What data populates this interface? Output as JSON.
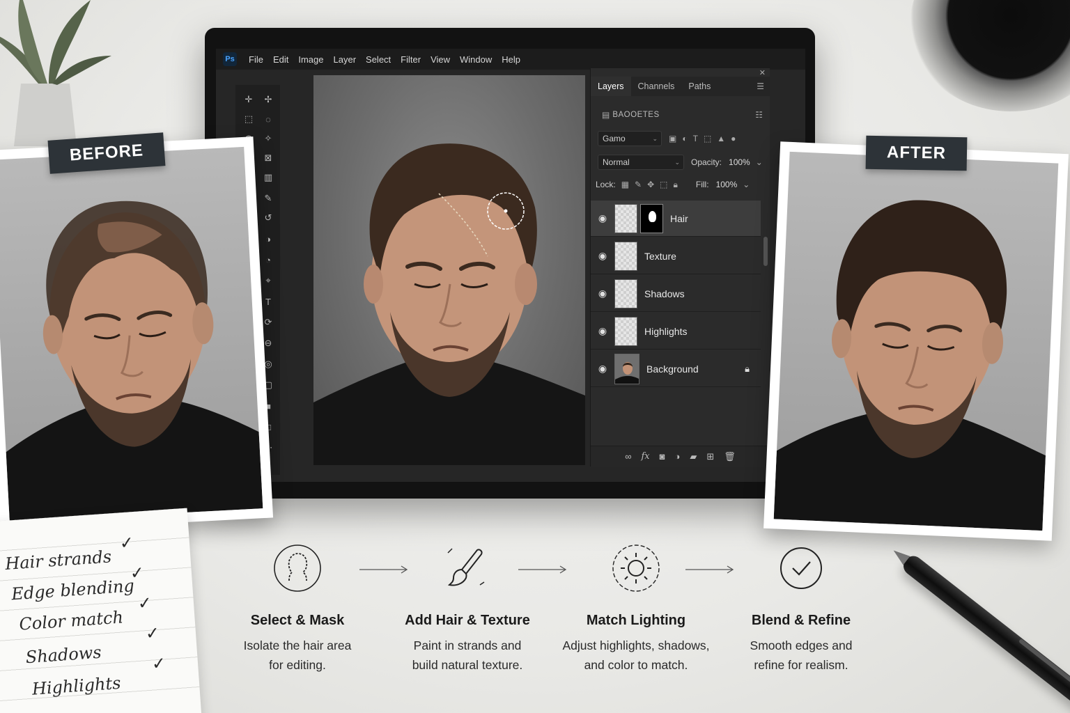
{
  "menu": {
    "items": [
      "File",
      "Edit",
      "Image",
      "Layer",
      "Select",
      "Filter",
      "View",
      "Window",
      "Help"
    ]
  },
  "layers_panel": {
    "tabs": [
      "Layers",
      "Channels",
      "Paths"
    ],
    "filter_label": "BAOOETES",
    "kind_value": "Gamo",
    "blend_mode": "Normal",
    "opacity_label": "Opacity:",
    "opacity_value": "100%",
    "lock_label": "Lock:",
    "fill_label": "Fill:",
    "fill_value": "100%",
    "layers": [
      {
        "name": "Hair",
        "selected": true,
        "locked": false
      },
      {
        "name": "Texture",
        "selected": false,
        "locked": false
      },
      {
        "name": "Shadows",
        "selected": false,
        "locked": false
      },
      {
        "name": "Highlights",
        "selected": false,
        "locked": false
      },
      {
        "name": "Background",
        "selected": false,
        "locked": true
      }
    ]
  },
  "photos": {
    "before_label": "BEFORE",
    "after_label": "AFTER"
  },
  "checklist": [
    {
      "text": "Hair strands",
      "checked": true
    },
    {
      "text": "Edge blending",
      "checked": true
    },
    {
      "text": "Color match",
      "checked": true
    },
    {
      "text": "Shadows",
      "checked": true
    },
    {
      "text": "Highlights",
      "checked": true
    }
  ],
  "steps": [
    {
      "icon": "head-silhouette-icon",
      "title": "Select & Mask",
      "line1": "Isolate the hair area",
      "line2": "for editing."
    },
    {
      "icon": "brush-icon",
      "title": "Add Hair & Texture",
      "line1": "Paint in strands and",
      "line2": "build natural texture."
    },
    {
      "icon": "sun-icon",
      "title": "Match Lighting",
      "line1": "Adjust highlights, shadows,",
      "line2": "and color to match."
    },
    {
      "icon": "checkmark-circle-icon",
      "title": "Blend & Refine",
      "line1": "Smooth edges and",
      "line2": "refine for realism."
    }
  ],
  "colors": {
    "dark_ui": "#262626",
    "tag_bg": "#2d3338",
    "paper": "#f3f3f1"
  }
}
